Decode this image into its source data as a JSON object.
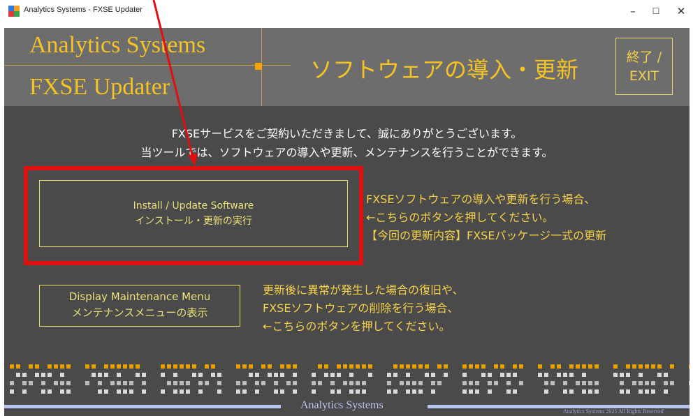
{
  "window": {
    "title": "Analytics Systems - FXSE Updater",
    "controls": {
      "minimize": "–",
      "maximize": "☐",
      "close": "✕"
    }
  },
  "header": {
    "brand_line1": "Analytics Systems",
    "brand_line2": "FXSE Updater",
    "title": "ソフトウェアの導入・更新",
    "exit_line1": "終了 /",
    "exit_line2": "EXIT"
  },
  "intro": {
    "line1": "FXSEサービスをご契約いただきまして、誠にありがとうございます。",
    "line2": "当ツールでは、ソフトウェアの導入や更新、メンテナンスを行うことができます。"
  },
  "install": {
    "button_line1": "Install / Update Software",
    "button_line2": "インストール・更新の実行",
    "desc_line1": "FXSEソフトウェアの導入や更新を行う場合、",
    "desc_line2": "←こちらのボタンを押してください。",
    "desc_line3": "【今回の更新内容】FXSEパッケージ一式の更新"
  },
  "maintenance": {
    "button_line1": "Display Maintenance Menu",
    "button_line2": "メンテナンスメニューの表示",
    "desc_line1": "更新後に異常が発生した場合の復旧や、",
    "desc_line2": "FXSEソフトウェアの削除を行う場合、",
    "desc_line3": "←こちらのボタンを押してください。"
  },
  "footer": {
    "brand": "Analytics Systems",
    "copyright": "Analytics Systems 2025 All Rights Reserved"
  },
  "colors": {
    "accent": "#f5c323",
    "background": "#4a4a4a",
    "header_bg": "#6d6d6d",
    "highlight": "#e01010",
    "footer_line": "#b8c4f0"
  },
  "annotation": {
    "type": "red-arrow-and-box",
    "target": "install-update-button"
  }
}
